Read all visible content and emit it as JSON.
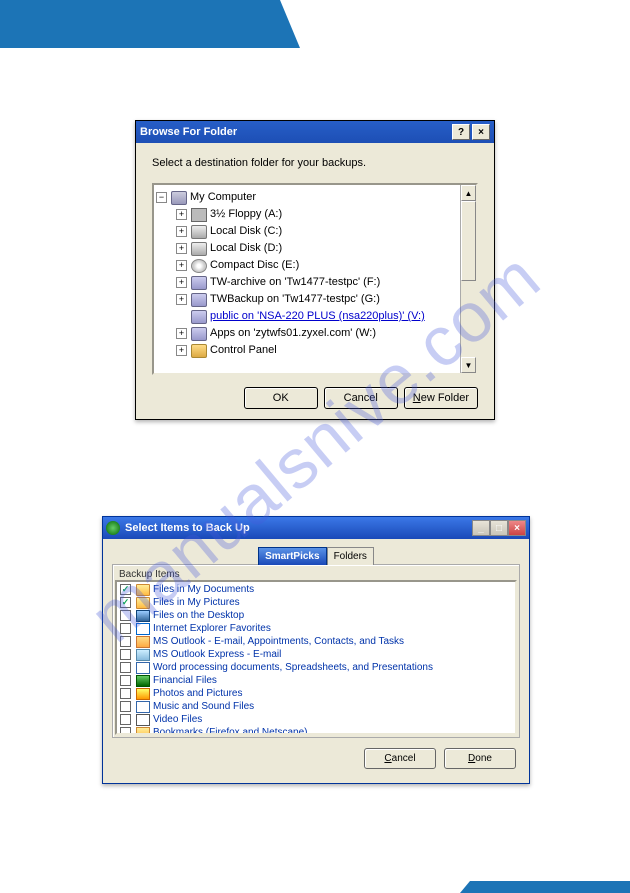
{
  "watermark": "manualsnive.com",
  "dlg1": {
    "title": "Browse For Folder",
    "help_symbol": "?",
    "close_symbol": "×",
    "instruction": "Select a destination folder for your backups.",
    "tree": {
      "root": "My Computer",
      "items": [
        {
          "exp": "+",
          "icon": "floppy",
          "label": "3½ Floppy (A:)"
        },
        {
          "exp": "+",
          "icon": "drive",
          "label": "Local Disk (C:)"
        },
        {
          "exp": "+",
          "icon": "drive",
          "label": "Local Disk (D:)"
        },
        {
          "exp": "+",
          "icon": "cd",
          "label": "Compact Disc (E:)"
        },
        {
          "exp": "+",
          "icon": "net",
          "label": "TW-archive on 'Tw1477-testpc' (F:)"
        },
        {
          "exp": "+",
          "icon": "net",
          "label": "TWBackup on 'Tw1477-testpc' (G:)"
        },
        {
          "exp": "",
          "icon": "net",
          "label": "public on 'NSA-220 PLUS (nsa220plus)' (V:)",
          "selected": true
        },
        {
          "exp": "+",
          "icon": "net",
          "label": "Apps on 'zytwfs01.zyxel.com' (W:)"
        },
        {
          "exp": "+",
          "icon": "ctrl",
          "label": "Control Panel"
        }
      ]
    },
    "buttons": {
      "ok": "OK",
      "cancel": "Cancel",
      "new_prefix": "N",
      "new_rest": "ew Folder"
    }
  },
  "dlg2": {
    "title": "Select Items to Back Up",
    "min_symbol": "_",
    "max_symbol": "□",
    "close_symbol": "×",
    "tabs": {
      "active": "SmartPicks",
      "inactive": "Folders"
    },
    "list_label": "Backup Items",
    "items": [
      {
        "checked": true,
        "icon": "folder",
        "label": "Files in My Documents"
      },
      {
        "checked": true,
        "icon": "folder",
        "label": "Files in My Pictures"
      },
      {
        "checked": false,
        "icon": "desktop",
        "label": "Files on the Desktop"
      },
      {
        "checked": false,
        "icon": "ie",
        "label": "Internet Explorer Favorites"
      },
      {
        "checked": false,
        "icon": "outlook",
        "label": "MS Outlook - E-mail, Appointments, Contacts, and Tasks"
      },
      {
        "checked": false,
        "icon": "oe",
        "label": "MS Outlook Express - E-mail"
      },
      {
        "checked": false,
        "icon": "word",
        "label": "Word processing documents, Spreadsheets, and Presentations"
      },
      {
        "checked": false,
        "icon": "money",
        "label": "Financial Files"
      },
      {
        "checked": false,
        "icon": "photo",
        "label": "Photos and Pictures"
      },
      {
        "checked": false,
        "icon": "music",
        "label": "Music and Sound Files"
      },
      {
        "checked": false,
        "icon": "video",
        "label": "Video Files"
      },
      {
        "checked": false,
        "icon": "book",
        "label": "Bookmarks (Firefox and Netscape)"
      }
    ],
    "buttons": {
      "cancel_prefix": "C",
      "cancel_rest": "ancel",
      "done_prefix": "D",
      "done_rest": "one"
    }
  }
}
